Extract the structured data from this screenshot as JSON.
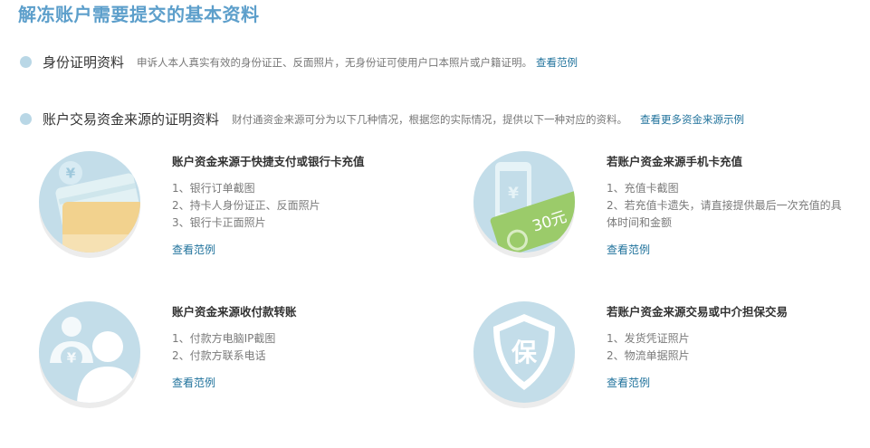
{
  "page": {
    "title": "解冻账户需要提交的基本资料"
  },
  "identity": {
    "title": "身份证明资料",
    "desc": "申诉人本人真实有效的身份证正、反面照片，无身份证可使用户口本照片或户籍证明。",
    "link": "查看范例"
  },
  "funds": {
    "title": "账户交易资金来源的证明资料",
    "desc": "财付通资金来源可分为以下几种情况，根据您的实际情况，提供以下一种对应的资料。",
    "link": "查看更多资金来源示例"
  },
  "cards": [
    {
      "title": "账户资金来源于快捷支付或银行卡充值",
      "items": [
        "1、银行订单截图",
        "2、持卡人身份证正、反面照片",
        "3、银行卡正面照片"
      ],
      "link": "查看范例",
      "icon": "bank-card-icon"
    },
    {
      "title": "若账户资金来源手机卡充值",
      "items": [
        "1、充值卡截图",
        "2、若充值卡遗失，请直接提供最后一次充值的具体时间和金额"
      ],
      "link": "查看范例",
      "icon": "mobile-recharge-icon",
      "badge": "30元"
    },
    {
      "title": "账户资金来源收付款转账",
      "items": [
        "1、付款方电脑IP截图",
        "2、付款方联系电话"
      ],
      "link": "查看范例",
      "icon": "transfer-user-icon"
    },
    {
      "title": "若账户资金来源交易或中介担保交易",
      "items": [
        "1、发货凭证照片",
        "2、物流单据照片"
      ],
      "link": "查看范例",
      "icon": "guarantee-shield-icon",
      "badge": "保"
    }
  ],
  "symbols": {
    "yen": "¥"
  },
  "colors": {
    "title": "#5d9fcb",
    "link": "#21739c",
    "circle": "#c3dde9",
    "bullet": "#b9d7e6"
  }
}
